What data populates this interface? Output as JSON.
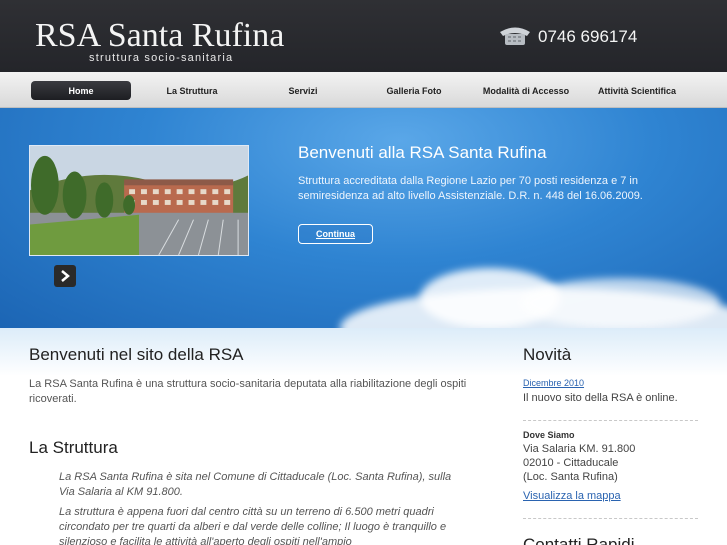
{
  "header": {
    "site_title": "RSA Santa Rufina",
    "subtitle": "struttura socio-sanitaria",
    "phone": "0746 696174",
    "phone_icon": "telephone-icon"
  },
  "nav": {
    "items": [
      {
        "label": "Home",
        "active": true
      },
      {
        "label": "La Struttura",
        "active": false
      },
      {
        "label": "Servizi",
        "active": false
      },
      {
        "label": "Galleria Foto",
        "active": false
      },
      {
        "label": "Modalità di Accesso",
        "active": false
      },
      {
        "label": "Attività Scientifica",
        "active": false
      }
    ]
  },
  "hero": {
    "title": "Benvenuti alla RSA Santa Rufina",
    "text": "Struttura accreditata dalla Regione Lazio per 70 posti residenza e 7 in semiresidenza ad alto livello Assistenziale. D.R. n. 448 del 16.06.2009.",
    "button_label": "Continua",
    "arrow_icon": "chevron-right-icon"
  },
  "main": {
    "welcome_title": "Benvenuti nel sito della RSA",
    "welcome_text": "La RSA Santa Rufina è una struttura socio-sanitaria deputata alla riabilitazione degli ospiti ricoverati.",
    "section_title": "La Struttura",
    "intro_1": "La RSA Santa Rufina è sita nel Comune di Cittaducale (Loc. Santa Rufina), sulla Via Salaria al KM 91.800.",
    "intro_2": "La struttura è appena fuori dal centro città su un terreno di 6.500 metri quadri circondato per tre quarti da alberi e dal verde delle colline; Il luogo è tranquillo e silenzioso e facilita le attività all'aperto degli ospiti nell'ampio"
  },
  "sidebar": {
    "news_title": "Novità",
    "news_date": "Dicembre 2010",
    "news_text": "Il nuovo sito della RSA è online.",
    "where_label": "Dove Siamo",
    "address_1": "Via Salaria KM. 91.800",
    "address_2": "02010 - Cittaducale",
    "address_3": "(Loc. Santa Rufina)",
    "map_link": "Visualizza la mappa",
    "contacts_title": "Contatti Rapidi"
  },
  "colors": {
    "header_bg": "#2a2b30",
    "hero_blue": "#2f84d2",
    "link_blue": "#2a63b0"
  }
}
